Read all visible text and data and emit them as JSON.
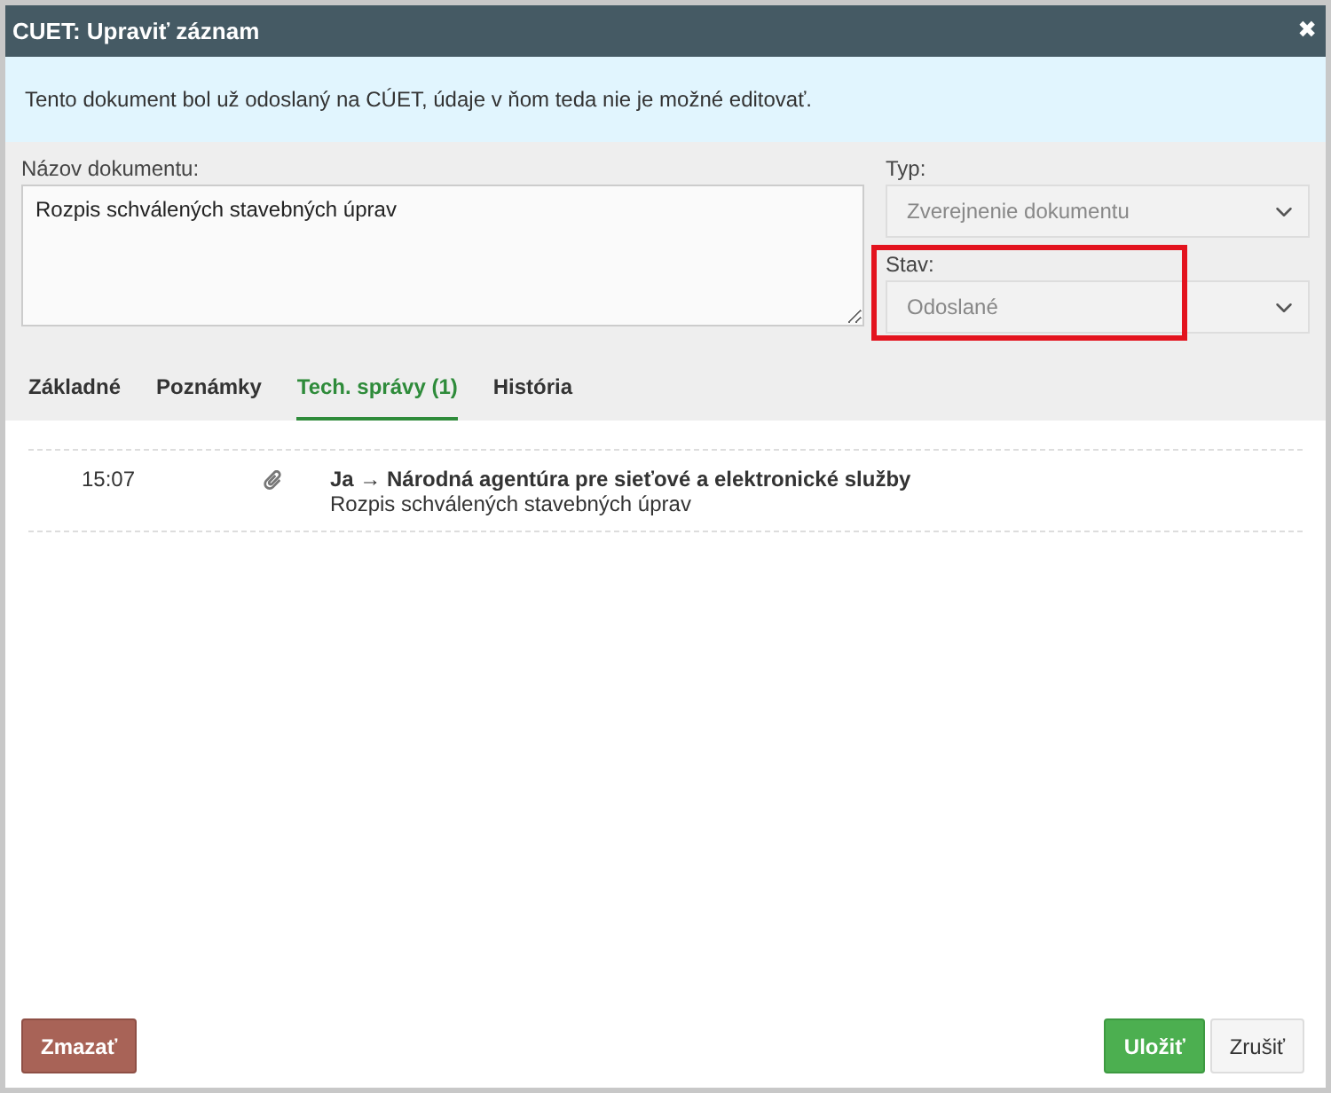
{
  "window": {
    "title": "CUET: Upraviť záznam",
    "close": "✖"
  },
  "notice": "Tento dokument bol už odoslaný na CÚET, údaje v ňom teda nie je možné editovať.",
  "form": {
    "name": {
      "label": "Názov dokumentu:",
      "value": "Rozpis schválených stavebných úprav"
    },
    "type": {
      "label": "Typ:",
      "value": "Zverejnenie dokumentu",
      "disabled": true
    },
    "state": {
      "label": "Stav:",
      "value": "Odoslané",
      "disabled": true,
      "highlighted": true
    }
  },
  "tabs": [
    {
      "label": "Základné",
      "selected": false
    },
    {
      "label": "Poznámky",
      "selected": false
    },
    {
      "label": "Tech. správy (1)",
      "selected": true
    },
    {
      "label": "História",
      "selected": false
    }
  ],
  "messages": [
    {
      "time": "15:07",
      "attachment": true,
      "title": "Ja → Národná agentúra pre sieťové a elektronické služby",
      "subtitle": "Rozpis schválených stavebných úprav"
    }
  ],
  "buttons": [
    {
      "label": "Zmazať",
      "kind": "danger"
    },
    {
      "label": "Uložiť",
      "kind": "primary"
    },
    {
      "label": "Zrušiť",
      "kind": "default"
    }
  ]
}
